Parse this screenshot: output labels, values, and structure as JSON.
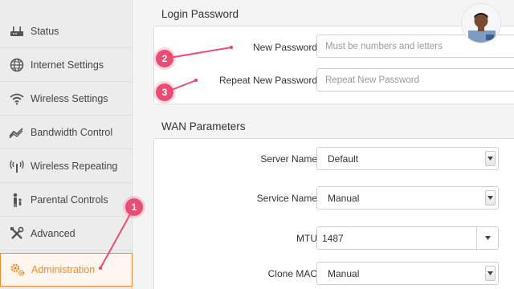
{
  "sidebar": {
    "items": [
      {
        "label": "Status",
        "icon": "router-icon"
      },
      {
        "label": "Internet Settings",
        "icon": "globe-icon"
      },
      {
        "label": "Wireless Settings",
        "icon": "wifi-icon"
      },
      {
        "label": "Bandwidth Control",
        "icon": "bandwidth-icon"
      },
      {
        "label": "Wireless Repeating",
        "icon": "repeater-icon"
      },
      {
        "label": "Parental Controls",
        "icon": "parental-icon"
      },
      {
        "label": "Advanced",
        "icon": "tools-icon"
      },
      {
        "label": "Administration",
        "icon": "gears-icon",
        "active": true
      }
    ]
  },
  "login_password": {
    "title": "Login Password",
    "new_password_label": "New Password",
    "new_password_placeholder": "Must be numbers and letters",
    "repeat_password_label": "Repeat New Password",
    "repeat_password_placeholder": "Repeat New Password"
  },
  "wan": {
    "title": "WAN Parameters",
    "server_name_label": "Server Name",
    "server_name_value": "Default",
    "service_name_label": "Service Name",
    "service_name_value": "Manual",
    "mtu_label": "MTU",
    "mtu_value": "1487",
    "clone_mac_label": "Clone MAC",
    "clone_mac_value": "Manual"
  },
  "callouts": {
    "one": "1",
    "two": "2",
    "three": "3"
  },
  "colors": {
    "accent": "#f08a2c",
    "callout": "#ea4d73"
  }
}
